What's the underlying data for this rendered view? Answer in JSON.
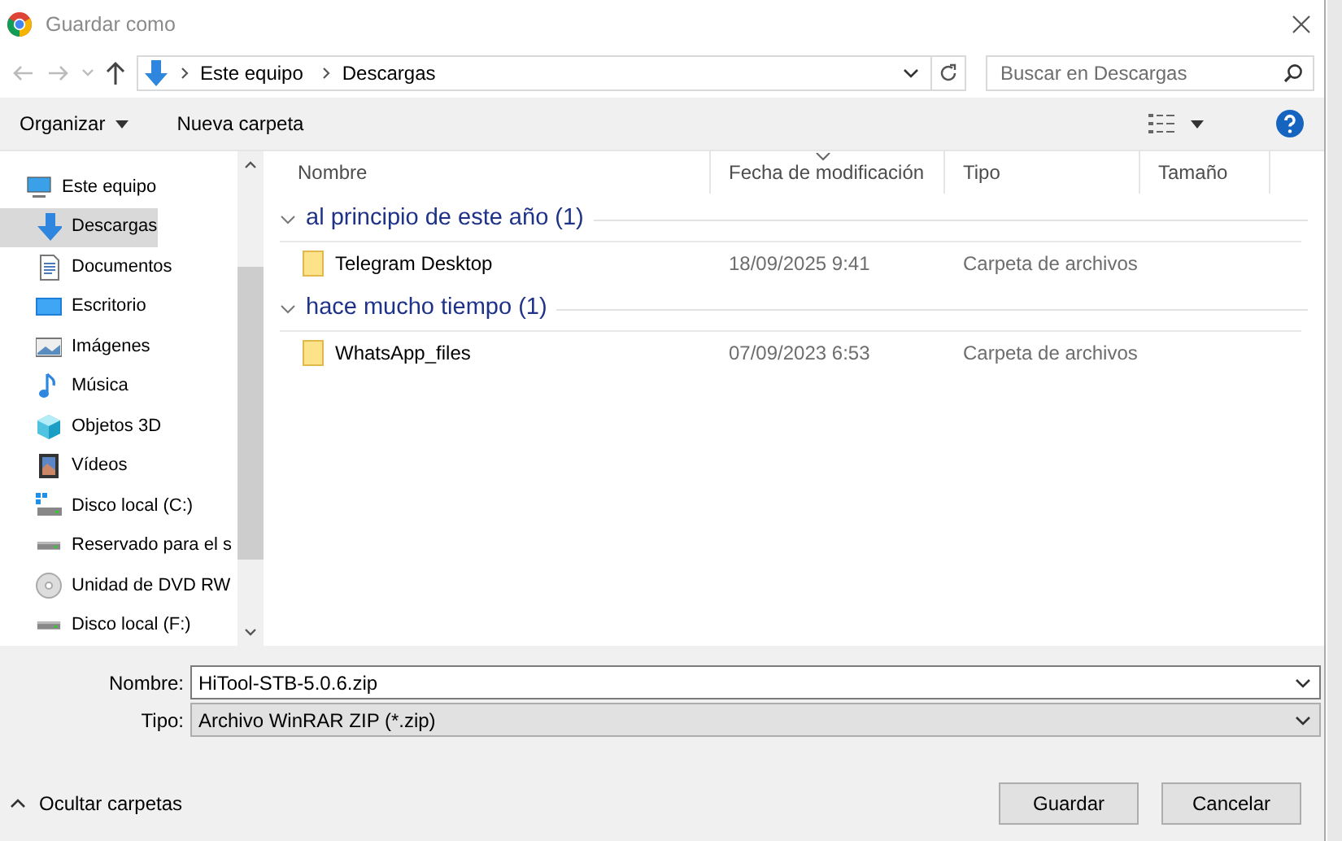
{
  "window": {
    "title": "Guardar como"
  },
  "address": {
    "path": [
      {
        "label": "Este equipo"
      },
      {
        "label": "Descargas"
      }
    ]
  },
  "search": {
    "placeholder": "Buscar en Descargas"
  },
  "toolbar": {
    "buttons": [
      {
        "label": "Organizar",
        "dropdown": true
      },
      {
        "label": "Nueva carpeta",
        "dropdown": false
      }
    ]
  },
  "sidebar": {
    "items": [
      {
        "label": "Este equipo",
        "kind": "computer",
        "selected": false,
        "children": [
          {
            "label": "Descargas",
            "kind": "download",
            "selected": true
          },
          {
            "label": "Documentos",
            "kind": "document",
            "selected": false
          },
          {
            "label": "Escritorio",
            "kind": "desktop",
            "selected": false
          },
          {
            "label": "Imágenes",
            "kind": "image",
            "selected": false
          },
          {
            "label": "Música",
            "kind": "music",
            "selected": false
          },
          {
            "label": "Objetos 3D",
            "kind": "cube",
            "selected": false
          },
          {
            "label": "Vídeos",
            "kind": "video",
            "selected": false
          },
          {
            "label": "Disco local (C:)",
            "kind": "system-drive",
            "selected": false
          },
          {
            "label": "Reservado para el s",
            "kind": "drive",
            "selected": false
          },
          {
            "label": "Unidad de DVD RW",
            "kind": "dvd",
            "selected": false
          },
          {
            "label": "Disco local (F:)",
            "kind": "drive",
            "selected": false
          }
        ]
      }
    ]
  },
  "table": {
    "columns": [
      {
        "label": "Nombre",
        "sorted": false
      },
      {
        "label": "Fecha de modificación",
        "sorted": true
      },
      {
        "label": "Tipo",
        "sorted": false
      },
      {
        "label": "Tamaño",
        "sorted": false
      }
    ],
    "groups": [
      {
        "label": "al principio de este año (1)",
        "expanded": true,
        "rows": [
          {
            "name": "Telegram Desktop",
            "date": "18/09/2025 9:41",
            "type": "Carpeta de archivos"
          }
        ]
      },
      {
        "label": "hace mucho tiempo (1)",
        "expanded": true,
        "rows": [
          {
            "name": "WhatsApp_files",
            "date": "07/09/2023 6:53",
            "type": "Carpeta de archivos"
          }
        ]
      }
    ]
  },
  "form": {
    "filename_label": "Nombre:",
    "filename": "HiTool-STB-5.0.6.zip",
    "type_label": "Tipo:",
    "type": "Archivo WinRAR ZIP (*.zip)"
  },
  "hide_folders": {
    "label": "Ocultar carpetas"
  },
  "buttons": [
    {
      "label": "Guardar"
    },
    {
      "label": "Cancelar"
    }
  ]
}
